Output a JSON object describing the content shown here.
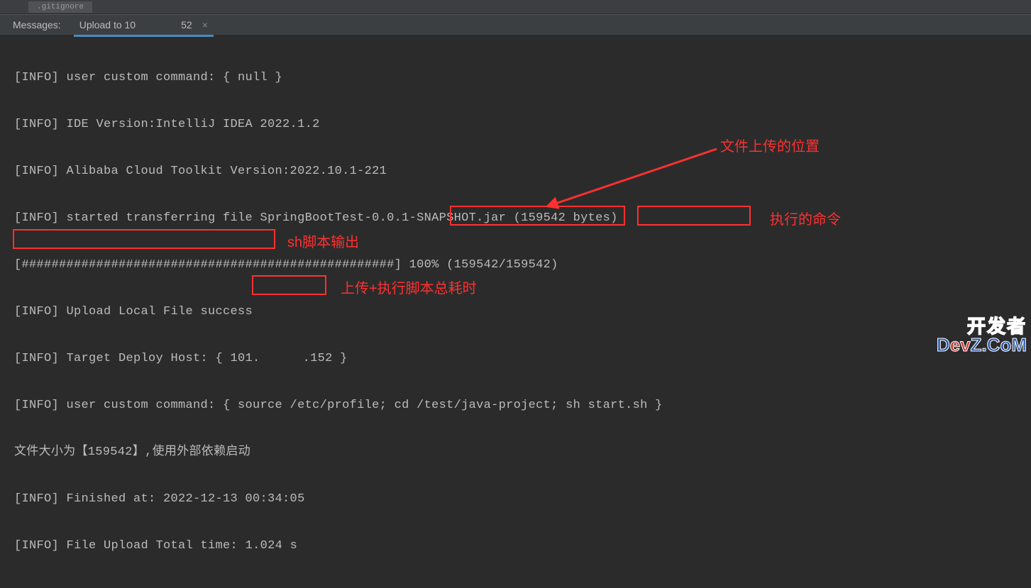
{
  "file_tab": {
    "label": ".gitignore"
  },
  "messages_bar": {
    "label": "Messages:",
    "upload_tab_prefix": "Upload to 10",
    "upload_tab_suffix": "52"
  },
  "console": {
    "l1": "[INFO] user custom command: { null }",
    "l2": "[INFO] IDE Version:IntelliJ IDEA 2022.1.2",
    "l3": "[INFO] Alibaba Cloud Toolkit Version:2022.10.1-221",
    "l4": "[INFO] started transferring file SpringBootTest-0.0.1-SNAPSHOT.jar (159542 bytes)",
    "l5": "[##################################################] 100% (159542/159542)",
    "l6": "[INFO] Upload Local File success",
    "l7_pre": "[INFO] Target Deploy Host: { 101.",
    "l7_post": ".152 }",
    "l8_pre": "[INFO] user custom command: { source /etc/profile; cd ",
    "l8_path": "/test/java-project",
    "l8_mid": "; ",
    "l8_cmd": "sh start.sh",
    "l8_post": " }",
    "l9": "文件大小为【159542】,使用外部依赖启动",
    "l10": "[INFO] Finished at: 2022-12-13 00:34:05",
    "l11_pre": "[INFO] File Upload Total time: ",
    "l11_time": "1.024 s"
  },
  "annot": {
    "upload_location": "文件上传的位置",
    "exec_cmd": "执行的命令",
    "sh_output": "sh脚本输出",
    "total_time": "上传+执行脚本总耗时"
  },
  "watermark": {
    "line1": "开发者"
  }
}
